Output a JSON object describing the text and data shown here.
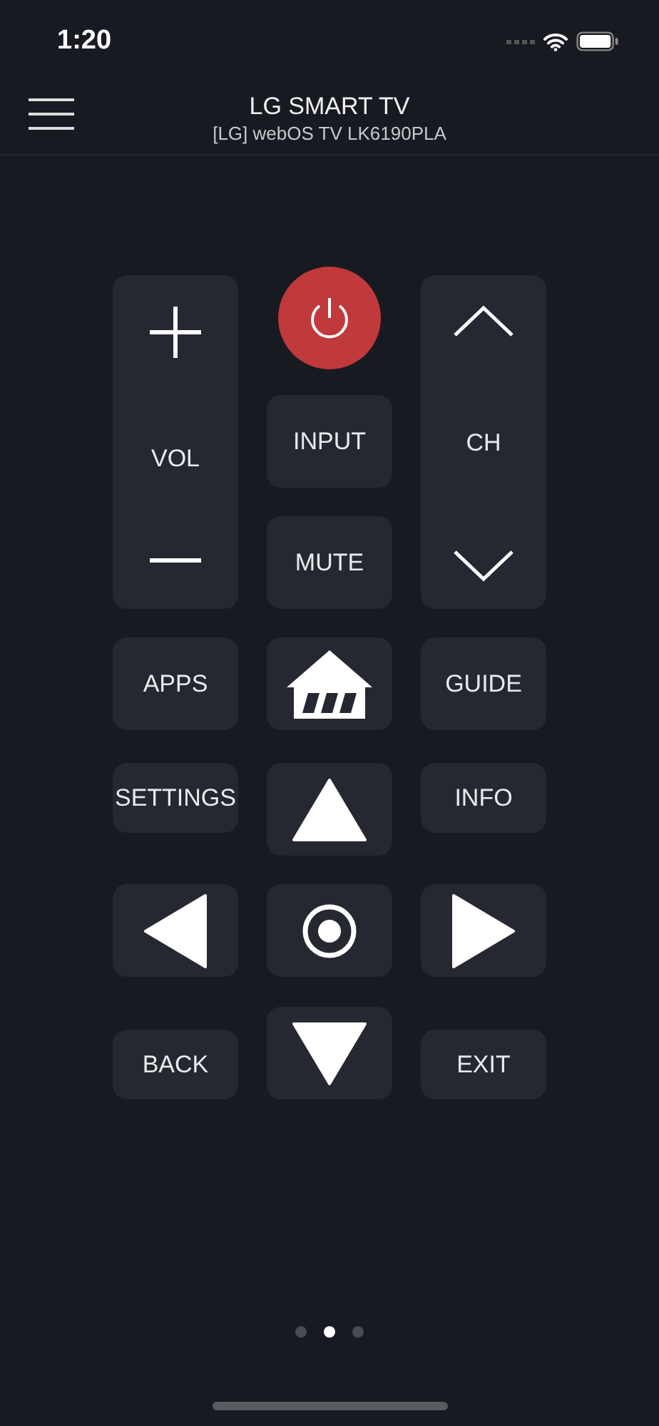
{
  "status_bar": {
    "time": "1:20"
  },
  "header": {
    "title": "LG SMART TV",
    "subtitle": "[LG] webOS TV LK6190PLA"
  },
  "columns": [
    [
      {
        "kind": "volume",
        "label": "VOL"
      },
      {
        "kind": "text",
        "label": "APPS"
      },
      {
        "kind": "short",
        "label": "SETTINGS"
      },
      {
        "kind": "left"
      },
      {
        "kind": "short",
        "label": "BACK"
      }
    ],
    [
      {
        "kind": "power"
      },
      {
        "kind": "text",
        "label": "INPUT"
      },
      {
        "kind": "text",
        "label": "MUTE"
      },
      {
        "kind": "home"
      },
      {
        "kind": "up"
      },
      {
        "kind": "ok"
      },
      {
        "kind": "down"
      }
    ],
    [
      {
        "kind": "channel",
        "label": "CH"
      },
      {
        "kind": "text",
        "label": "GUIDE"
      },
      {
        "kind": "short",
        "label": "INFO"
      },
      {
        "kind": "right"
      },
      {
        "kind": "short",
        "label": "EXIT"
      }
    ]
  ],
  "pages": [
    {
      "selected": false
    },
    {
      "selected": true
    },
    {
      "selected": false
    }
  ]
}
